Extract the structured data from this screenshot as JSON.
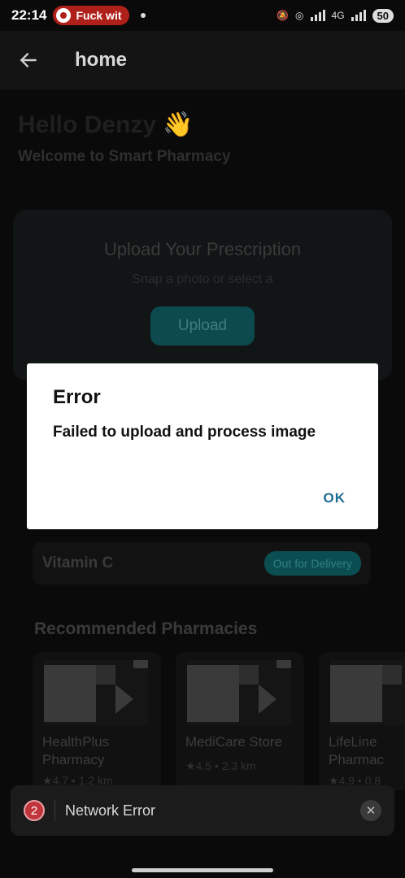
{
  "status_bar": {
    "time": "22:14",
    "notification": "Fuck wit",
    "battery": "50",
    "network": "4G"
  },
  "appbar": {
    "title": "home"
  },
  "greeting": {
    "title": "Hello Denzy",
    "emoji": "👋",
    "subtitle": "Welcome to Smart Pharmacy"
  },
  "upload": {
    "title": "Upload Your Prescription",
    "subtitle": "Snap a photo or select a",
    "button_label": "Upload"
  },
  "order": {
    "medicine": "Vitamin C",
    "status": "Out for Delivery"
  },
  "recommended": {
    "title": "Recommended Pharmacies",
    "items": [
      {
        "name": "HealthPlus Pharmacy",
        "meta": "★4.7 • 1.2 km"
      },
      {
        "name": "MediCare Store",
        "meta": "★4.5 • 2.3 km"
      },
      {
        "name": "LifeLine Pharmac",
        "meta": "★4.9 • 0.8"
      }
    ]
  },
  "dialog": {
    "title": "Error",
    "message": "Failed to upload and process image",
    "ok_label": "OK"
  },
  "toast": {
    "count": "2",
    "message": "Network Error"
  },
  "colors": {
    "accent": "#1d6e96",
    "teal": "#0c4a4d",
    "error": "#c0343b"
  }
}
